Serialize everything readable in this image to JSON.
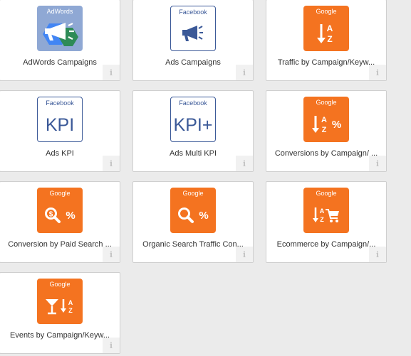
{
  "colors": {
    "google_orange": "#f47320",
    "facebook_blue": "#3b5998",
    "adwords_bg": "#8fa8d4"
  },
  "info_glyph": "i",
  "cards": [
    {
      "brand": "AdWords",
      "icon": "adwords-megaphone-icon",
      "caption": "AdWords Campaigns"
    },
    {
      "brand": "Facebook",
      "icon": "megaphone-icon",
      "caption": "Ads Campaigns"
    },
    {
      "brand": "Google",
      "icon": "sort-az-icon",
      "caption": "Traffic by Campaign/Keyw..."
    },
    {
      "brand": "Facebook",
      "icon": "kpi-icon",
      "icon_text": "KPI",
      "caption": "Ads KPI"
    },
    {
      "brand": "Facebook",
      "icon": "kpi-plus-icon",
      "icon_text": "KPI+",
      "caption": "Ads Multi KPI"
    },
    {
      "brand": "Google",
      "icon": "sort-az-percent-icon",
      "icon_text": "%",
      "caption": "Conversions by Campaign/ ..."
    },
    {
      "brand": "Google",
      "icon": "dollar-search-percent-icon",
      "icon_text": "%",
      "caption": "Conversion by Paid Search ..."
    },
    {
      "brand": "Google",
      "icon": "search-percent-icon",
      "icon_text": "%",
      "caption": "Organic Search Traffic Con..."
    },
    {
      "brand": "Google",
      "icon": "sort-az-cart-icon",
      "caption": "Ecommerce by Campaign/..."
    },
    {
      "brand": "Google",
      "icon": "cocktail-sort-az-icon",
      "caption": "Events by Campaign/Keyw..."
    }
  ]
}
